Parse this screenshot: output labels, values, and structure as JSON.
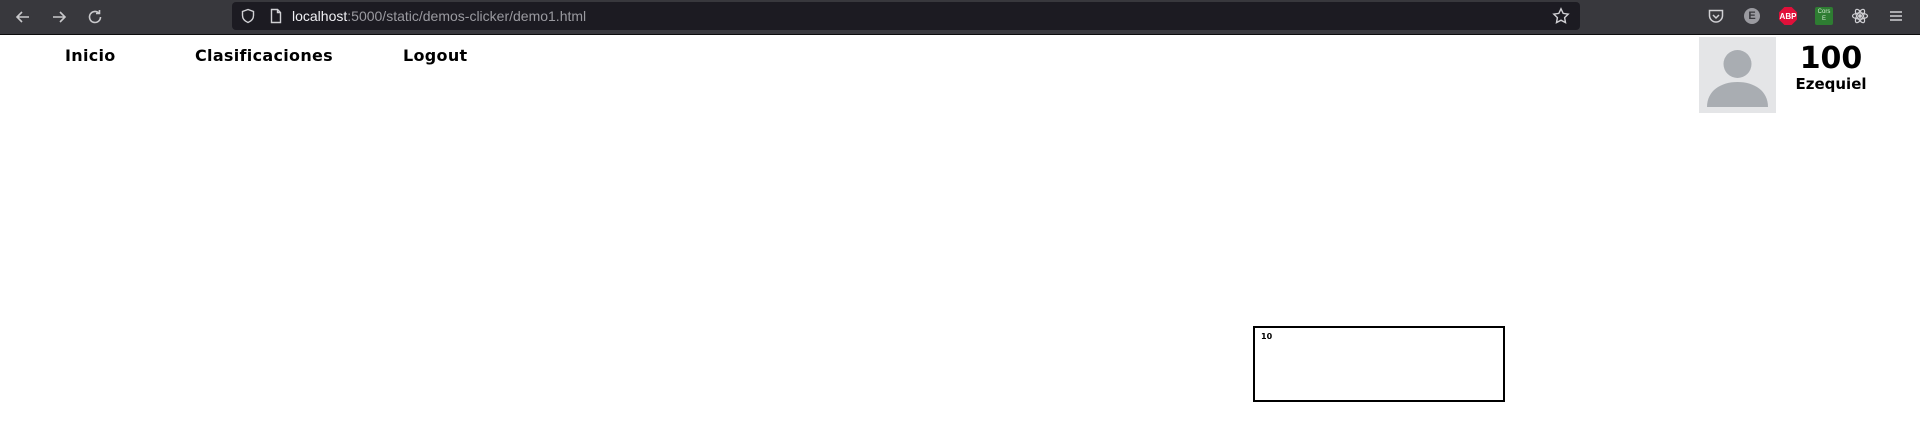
{
  "browser": {
    "url_host": "localhost",
    "url_rest": ":5000/static/demos-clicker/demo1.html",
    "extensions": {
      "e_label": "E",
      "abp_label": "ABP",
      "cors_line1": "Cors",
      "cors_line2": "E"
    }
  },
  "nav": {
    "inicio": "Inicio",
    "clasificaciones": "Clasificaciones",
    "logout": "Logout"
  },
  "user": {
    "score": "100",
    "name": "Ezequiel"
  },
  "clicker": {
    "value": "10"
  }
}
